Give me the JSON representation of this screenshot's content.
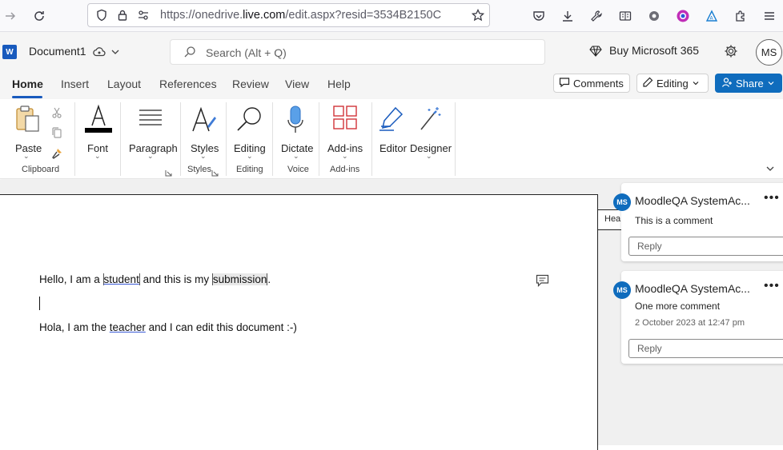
{
  "browser": {
    "url_prefix": "https://onedrive.",
    "url_domain": "live.com",
    "url_suffix": "/edit.aspx?resid=3534B2150C"
  },
  "app": {
    "logo_letter": "W",
    "doc_title": "Document1",
    "search_placeholder": "Search (Alt + Q)",
    "buy_label": "Buy Microsoft 365",
    "avatar_initials": "MS"
  },
  "tabs": [
    {
      "label": "Home"
    },
    {
      "label": "Insert"
    },
    {
      "label": "Layout"
    },
    {
      "label": "References"
    },
    {
      "label": "Review"
    },
    {
      "label": "View"
    },
    {
      "label": "Help"
    }
  ],
  "actions": {
    "comments": "Comments",
    "editing": "Editing",
    "share": "Share"
  },
  "ribbon": {
    "paste": "Paste",
    "font": "Font",
    "paragraph": "Paragraph",
    "styles": "Styles",
    "editing": "Editing",
    "dictate": "Dictate",
    "addins": "Add-ins",
    "editor": "Editor",
    "designer": "Designer",
    "groups": {
      "clipboard": "Clipboard",
      "styles": "Styles",
      "editing": "Editing",
      "voice": "Voice",
      "addins": "Add-ins"
    }
  },
  "document": {
    "line1": {
      "a": "Hello, I am a ",
      "b": "student",
      "c": " and this is my ",
      "d": "submission",
      "e": "."
    },
    "line3": {
      "a": "Hola, I am the ",
      "b": "teacher",
      "c": " and I can edit this document :-)"
    },
    "header_tab": "Hea"
  },
  "comments": [
    {
      "initials": "MS",
      "author": "MoodleQA SystemAc...",
      "text": "This is a comment",
      "date": "",
      "reply": "Reply"
    },
    {
      "initials": "MS",
      "author": "MoodleQA SystemAc...",
      "text": "One more comment",
      "date": "2 October 2023 at 12:47 pm",
      "reply": "Reply"
    }
  ]
}
